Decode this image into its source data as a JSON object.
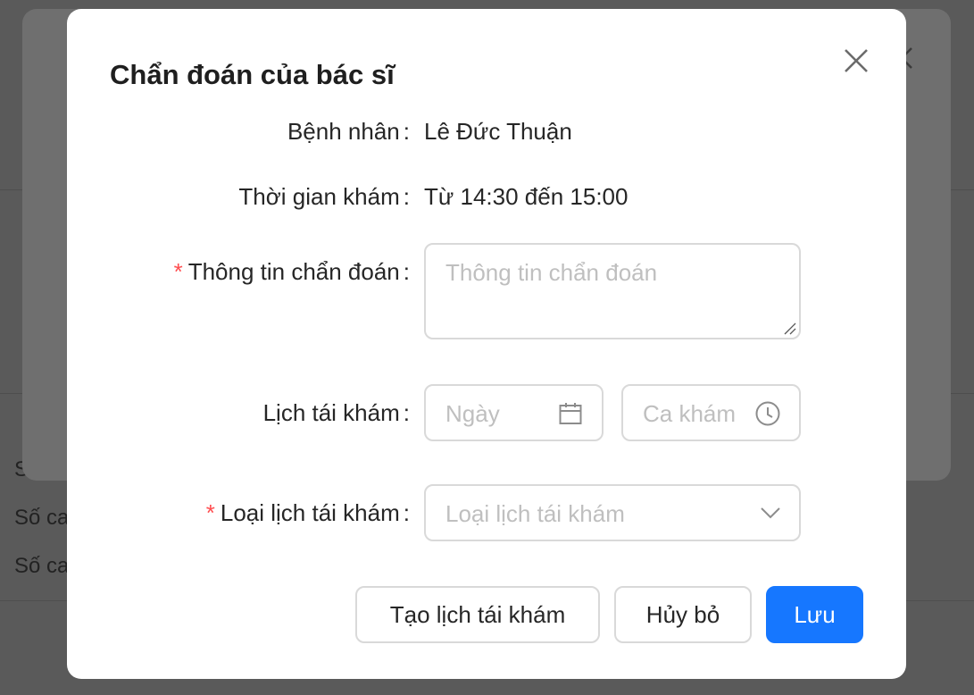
{
  "background": {
    "row_labels": [
      "Số",
      "Số ca",
      "Số ca"
    ]
  },
  "modal": {
    "title": "Chẩn đoán của bác sĩ",
    "patient": {
      "label": "Bệnh nhân",
      "value": "Lê Đức Thuận"
    },
    "exam_time": {
      "label": "Thời gian khám",
      "value": "Từ 14:30 đến 15:00"
    },
    "diagnosis": {
      "label": "Thông tin chẩn đoán",
      "required": "*",
      "placeholder": "Thông tin chẩn đoán"
    },
    "followup_schedule": {
      "label": "Lịch tái khám",
      "date_placeholder": "Ngày",
      "date_icon": "calendar-icon",
      "shift_placeholder": "Ca khám",
      "shift_icon": "clock-icon"
    },
    "followup_type": {
      "label": "Loại lịch tái khám",
      "required": "*",
      "placeholder": "Loại lịch tái khám",
      "icon": "chevron-down-icon"
    },
    "colon": ":",
    "buttons": {
      "create": "Tạo lịch tái khám",
      "cancel": "Hủy bỏ",
      "save": "Lưu"
    }
  },
  "colors": {
    "primary": "#1677ff",
    "required": "#ff4d4f",
    "overlay": "#5a5a5a"
  }
}
